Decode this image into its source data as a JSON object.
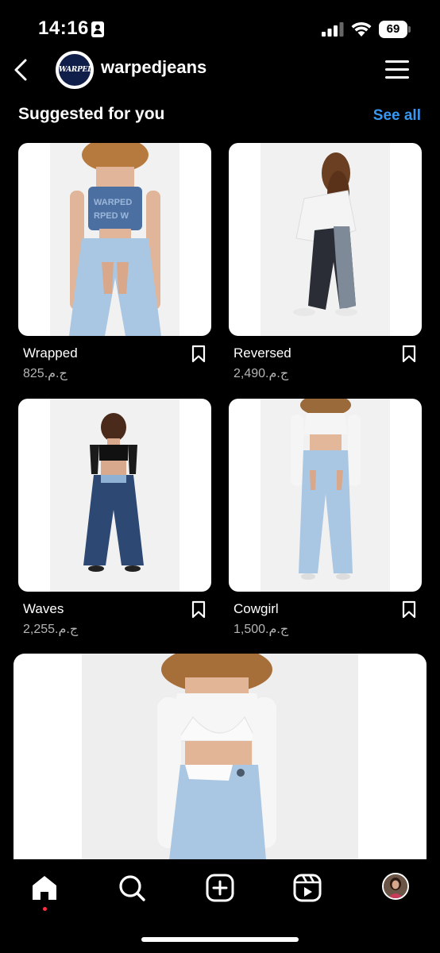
{
  "status_bar": {
    "time": "14:16",
    "battery": "69",
    "icons": [
      "contact-card-icon",
      "signal-icon",
      "wifi-icon",
      "battery-icon"
    ]
  },
  "header": {
    "account_name": "warpedjeans",
    "logo_text": "WARPED",
    "icons": [
      "back-icon",
      "menu-icon"
    ]
  },
  "section": {
    "title": "Suggested for you",
    "see_all_label": "See all"
  },
  "products": [
    {
      "name": "Wrapped",
      "price": "ج.م.825"
    },
    {
      "name": "Reversed",
      "price": "ج.م.2,490"
    },
    {
      "name": "Waves",
      "price": "ج.م.2,255"
    },
    {
      "name": "Cowgirl",
      "price": "ج.م.1,500"
    }
  ],
  "bottom_nav": {
    "items": [
      "home-icon",
      "search-icon",
      "create-icon",
      "reels-icon",
      "profile-avatar"
    ]
  },
  "colors": {
    "background": "#000000",
    "accent": "#3897f0",
    "notification_dot": "#ff3040",
    "secondary_text": "#b5b5b5"
  }
}
